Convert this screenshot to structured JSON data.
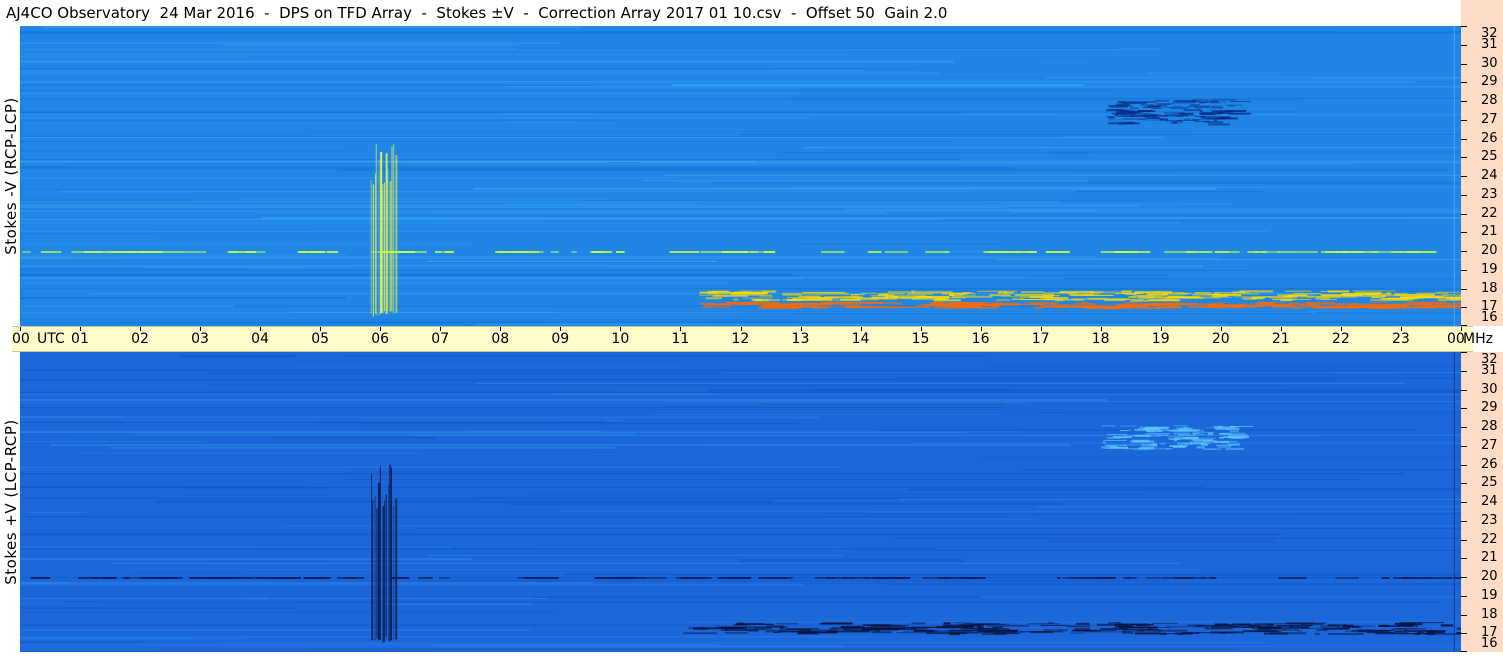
{
  "header": {
    "title": "AJ4CO Observatory  24 Mar 2016  -  DPS on TFD Array  -  Stokes ±V  -  Correction Array 2017 01 10.csv  -  Offset 50  Gain 2.0"
  },
  "chart_data": [
    {
      "type": "heatmap",
      "ylabel": "Stokes -V (RCP-LCP)",
      "xlabel": "UTC",
      "y_unit": "MHz",
      "xlim": [
        0,
        24
      ],
      "ylim": [
        16,
        32
      ],
      "yticks": [
        16,
        17,
        18,
        19,
        20,
        21,
        22,
        23,
        24,
        25,
        26,
        27,
        28,
        29,
        30,
        31,
        32
      ],
      "background_color": "#1f86e6",
      "features": [
        {
          "name": "burst",
          "t_start": 5.83,
          "t_end": 6.27,
          "f_low": 16.5,
          "f_high": 26.0,
          "color": "#ffff40"
        },
        {
          "name": "band",
          "t_start": 11.3,
          "t_end": 24,
          "f_low": 17.4,
          "f_high": 17.9,
          "color": "#ffdd00"
        },
        {
          "name": "band",
          "t_start": 11.3,
          "t_end": 24,
          "f_low": 17.0,
          "f_high": 17.3,
          "color": "#ff6a00"
        },
        {
          "name": "line",
          "t_start": 0,
          "t_end": 24,
          "f_low": 19.9,
          "f_high": 20.1,
          "color": "#c8ff30"
        },
        {
          "name": "dark-patch",
          "t_start": 18.0,
          "t_end": 20.2,
          "f_low": 26.8,
          "f_high": 28.1,
          "color": "#082a80"
        }
      ]
    },
    {
      "type": "heatmap",
      "ylabel": "Stokes +V (LCP-RCP)",
      "xlabel": "UTC",
      "y_unit": "MHz",
      "xlim": [
        0,
        24
      ],
      "ylim": [
        16,
        32
      ],
      "yticks": [
        16,
        17,
        18,
        19,
        20,
        21,
        22,
        23,
        24,
        25,
        26,
        27,
        28,
        29,
        30,
        31,
        32
      ],
      "background_color": "#1b66d8",
      "features": [
        {
          "name": "burst",
          "t_start": 5.83,
          "t_end": 6.27,
          "f_low": 16.5,
          "f_high": 26.0,
          "color": "#06103c"
        },
        {
          "name": "band",
          "t_start": 11.0,
          "t_end": 24,
          "f_low": 17.0,
          "f_high": 17.6,
          "color": "#06103c"
        },
        {
          "name": "line",
          "t_start": 0,
          "t_end": 24,
          "f_low": 19.9,
          "f_high": 20.1,
          "color": "#0a1c5a"
        },
        {
          "name": "light-patch",
          "t_start": 18.0,
          "t_end": 20.2,
          "f_low": 26.8,
          "f_high": 28.1,
          "color": "#5fc8ff"
        }
      ]
    }
  ],
  "time_axis": {
    "labels": [
      "00",
      "01",
      "02",
      "03",
      "04",
      "05",
      "06",
      "07",
      "08",
      "09",
      "10",
      "11",
      "12",
      "13",
      "14",
      "15",
      "16",
      "17",
      "18",
      "19",
      "20",
      "21",
      "22",
      "23",
      "00"
    ],
    "unit_left": "UTC",
    "unit_right": "MHz"
  }
}
